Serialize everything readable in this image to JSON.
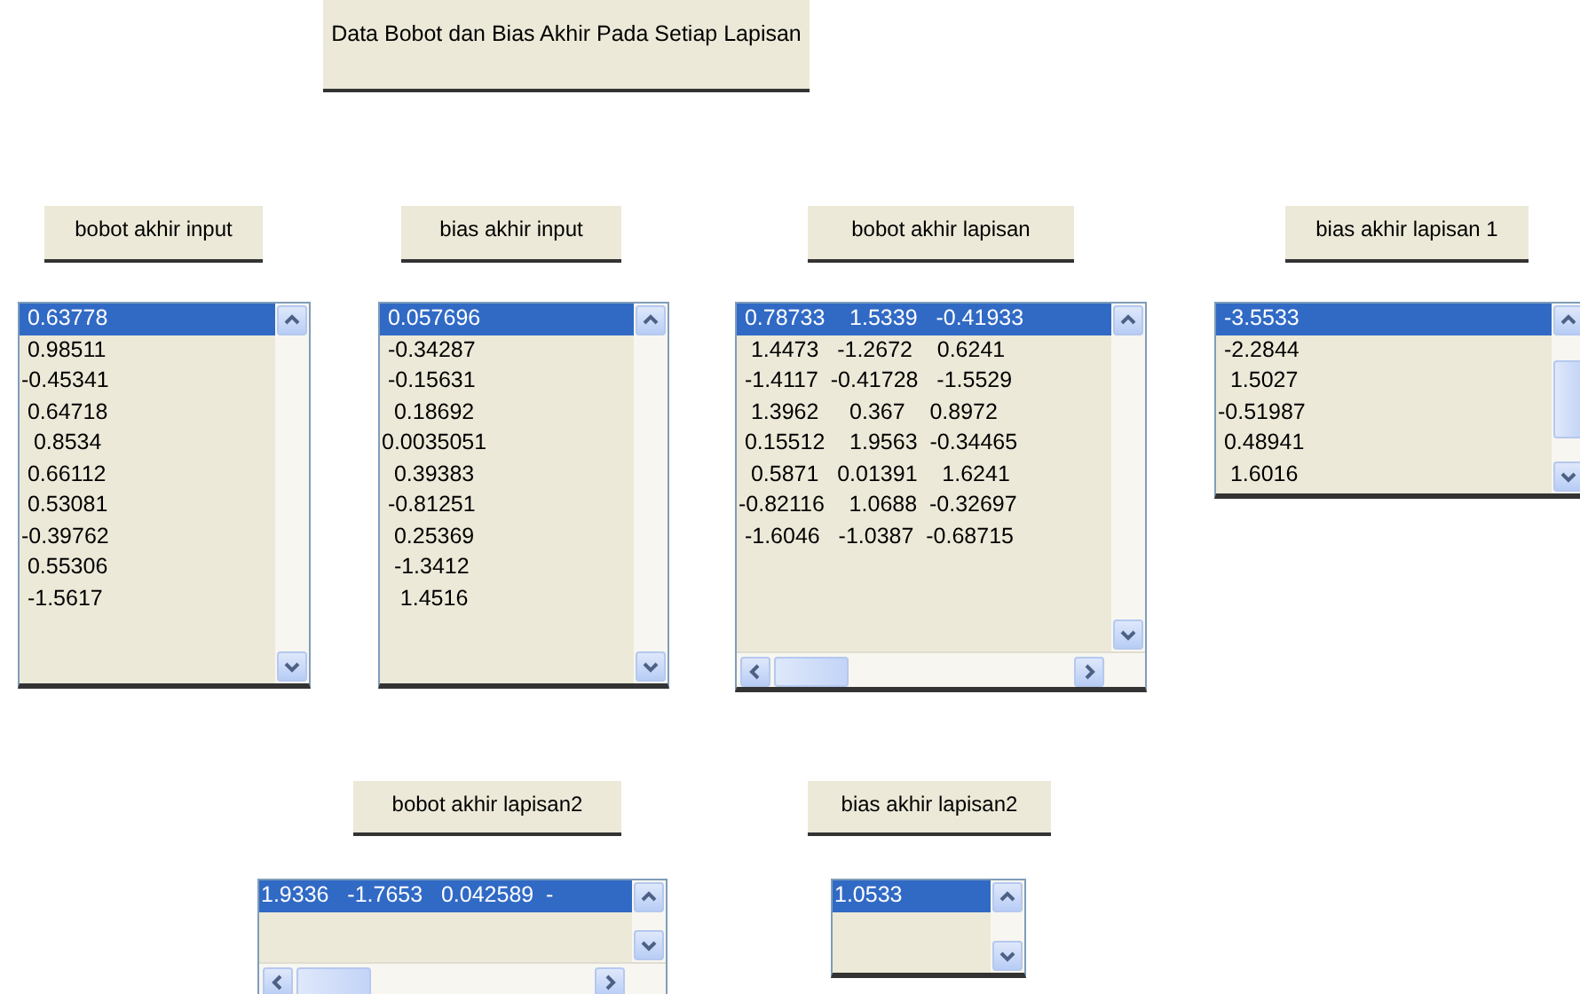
{
  "title": "Data Bobot dan Bias Akhir Pada Setiap Lapisan",
  "lists": [
    {
      "label": "bobot akhir input",
      "items": [
        {
          "text": " 0.63778",
          "selected": true
        },
        {
          "text": " 0.98511",
          "selected": false
        },
        {
          "text": "-0.45341",
          "selected": false
        },
        {
          "text": " 0.64718",
          "selected": false
        },
        {
          "text": "  0.8534",
          "selected": false
        },
        {
          "text": " 0.66112",
          "selected": false
        },
        {
          "text": " 0.53081",
          "selected": false
        },
        {
          "text": "-0.39762",
          "selected": false
        },
        {
          "text": " 0.55306",
          "selected": false
        },
        {
          "text": " -1.5617",
          "selected": false
        }
      ]
    },
    {
      "label": "bias akhir input",
      "items": [
        {
          "text": " 0.057696",
          "selected": true
        },
        {
          "text": " -0.34287",
          "selected": false
        },
        {
          "text": " -0.15631",
          "selected": false
        },
        {
          "text": "  0.18692",
          "selected": false
        },
        {
          "text": "0.0035051",
          "selected": false
        },
        {
          "text": "  0.39383",
          "selected": false
        },
        {
          "text": " -0.81251",
          "selected": false
        },
        {
          "text": "  0.25369",
          "selected": false
        },
        {
          "text": "  -1.3412",
          "selected": false
        },
        {
          "text": "   1.4516",
          "selected": false
        }
      ]
    },
    {
      "label": "bobot akhir lapisan",
      "items": [
        {
          "text": " 0.78733    1.5339   -0.41933",
          "selected": true
        },
        {
          "text": "  1.4473   -1.2672    0.6241",
          "selected": false
        },
        {
          "text": " -1.4117  -0.41728   -1.5529",
          "selected": false
        },
        {
          "text": "  1.3962     0.367    0.8972",
          "selected": false
        },
        {
          "text": " 0.15512    1.9563  -0.34465",
          "selected": false
        },
        {
          "text": "  0.5871   0.01391    1.6241",
          "selected": false
        },
        {
          "text": "-0.82116    1.0688  -0.32697",
          "selected": false
        },
        {
          "text": " -1.6046   -1.0387  -0.68715",
          "selected": false
        }
      ]
    },
    {
      "label": "bias akhir lapisan 1",
      "items": [
        {
          "text": " -3.5533",
          "selected": true
        },
        {
          "text": " -2.2844",
          "selected": false
        },
        {
          "text": "  1.5027",
          "selected": false
        },
        {
          "text": "-0.51987",
          "selected": false
        },
        {
          "text": " 0.48941",
          "selected": false
        },
        {
          "text": "  1.6016",
          "selected": false
        }
      ]
    },
    {
      "label": "bobot akhir lapisan2",
      "items": [
        {
          "text": "1.9336   -1.7653   0.042589  -",
          "selected": true
        }
      ]
    },
    {
      "label": "bias akhir lapisan2",
      "items": [
        {
          "text": "1.0533",
          "selected": true
        }
      ]
    }
  ]
}
